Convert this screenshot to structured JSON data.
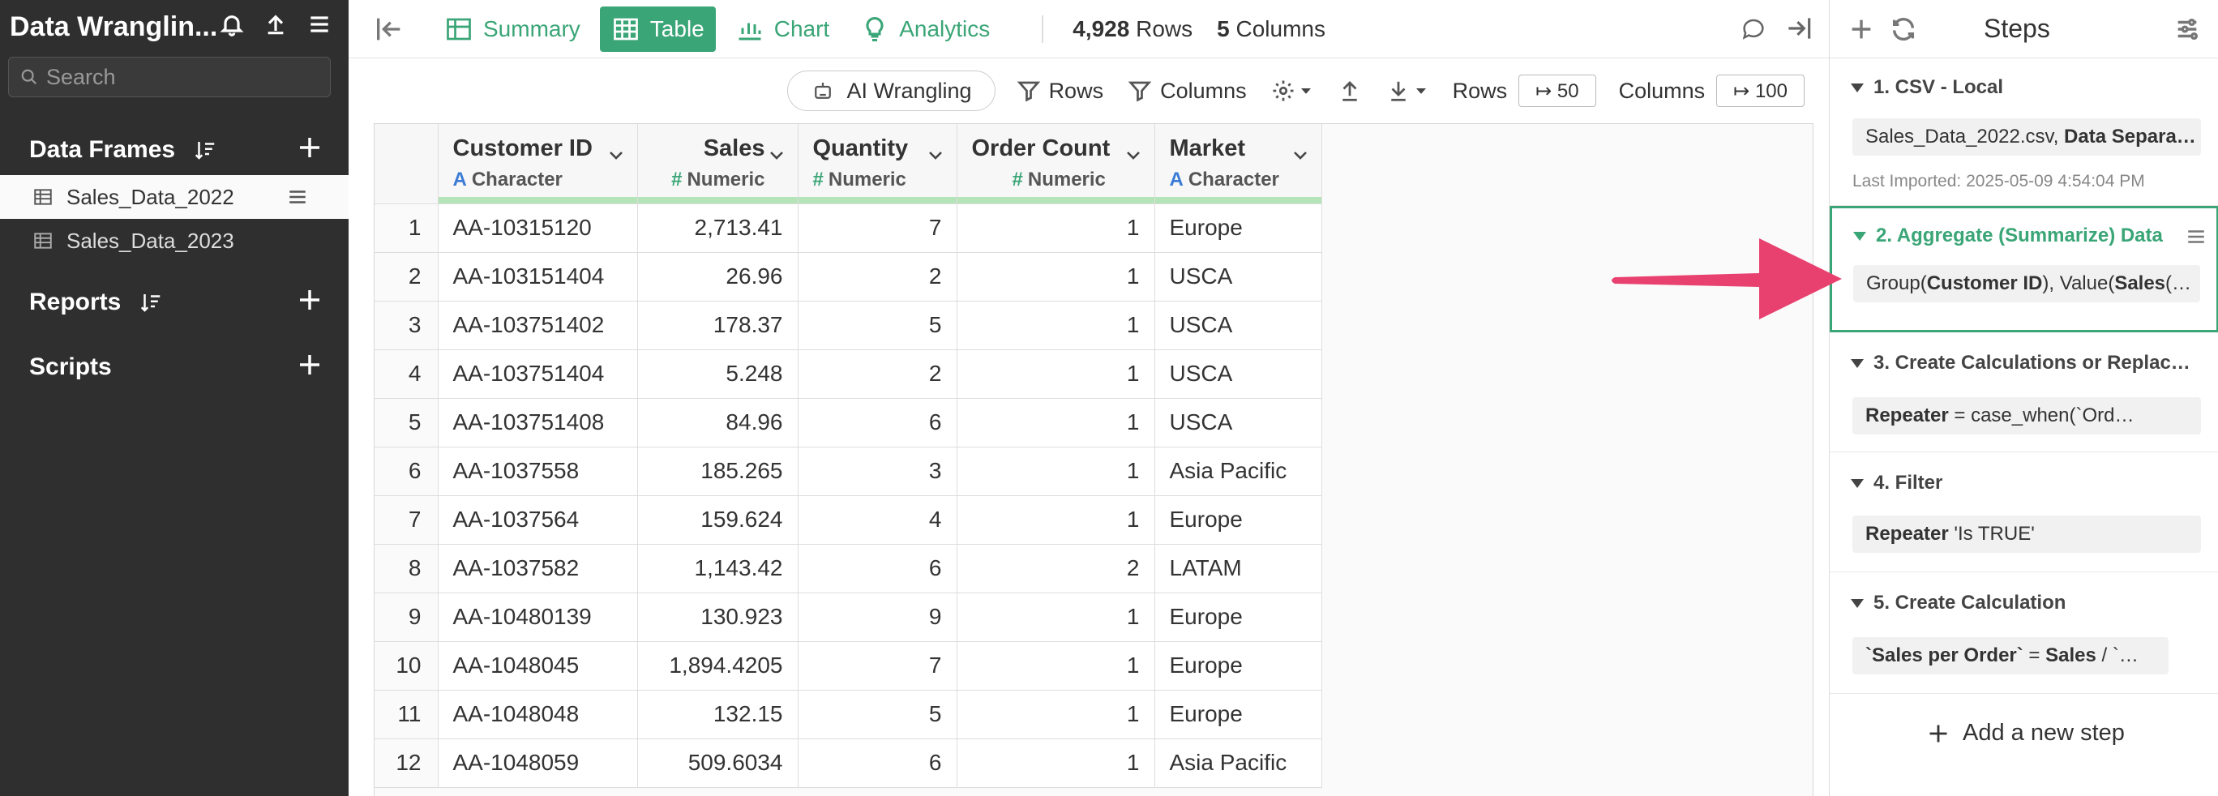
{
  "sidebar": {
    "title": "Data Wranglin...",
    "search_placeholder": "Search",
    "sections": {
      "data_frames": "Data Frames",
      "reports": "Reports",
      "scripts": "Scripts"
    },
    "frames": [
      "Sales_Data_2022",
      "Sales_Data_2023"
    ]
  },
  "topbar": {
    "tabs": [
      "Summary",
      "Table",
      "Chart",
      "Analytics"
    ],
    "active_tab": "Table",
    "rows_count": "4,928",
    "rows_label": "Rows",
    "cols_count": "5",
    "cols_label": "Columns"
  },
  "toolbar": {
    "ai": "AI Wrangling",
    "rows": "Rows",
    "columns": "Columns",
    "rows_label": "Rows",
    "rows_value": "↦ 50",
    "cols_label": "Columns",
    "cols_value": "↦ 100"
  },
  "table": {
    "columns": [
      {
        "name": "Customer ID",
        "type": "Character"
      },
      {
        "name": "Sales",
        "type": "Numeric"
      },
      {
        "name": "Quantity",
        "type": "Numeric"
      },
      {
        "name": "Order Count",
        "type": "Numeric"
      },
      {
        "name": "Market",
        "type": "Character"
      }
    ],
    "rows": [
      [
        "1",
        "AA-10315120",
        "2,713.41",
        "7",
        "1",
        "Europe"
      ],
      [
        "2",
        "AA-103151404",
        "26.96",
        "2",
        "1",
        "USCA"
      ],
      [
        "3",
        "AA-103751402",
        "178.37",
        "5",
        "1",
        "USCA"
      ],
      [
        "4",
        "AA-103751404",
        "5.248",
        "2",
        "1",
        "USCA"
      ],
      [
        "5",
        "AA-103751408",
        "84.96",
        "6",
        "1",
        "USCA"
      ],
      [
        "6",
        "AA-1037558",
        "185.265",
        "3",
        "1",
        "Asia Pacific"
      ],
      [
        "7",
        "AA-1037564",
        "159.624",
        "4",
        "1",
        "Europe"
      ],
      [
        "8",
        "AA-1037582",
        "1,143.42",
        "6",
        "2",
        "LATAM"
      ],
      [
        "9",
        "AA-10480139",
        "130.923",
        "9",
        "1",
        "Europe"
      ],
      [
        "10",
        "AA-1048045",
        "1,894.4205",
        "7",
        "1",
        "Europe"
      ],
      [
        "11",
        "AA-1048048",
        "132.15",
        "5",
        "1",
        "Europe"
      ],
      [
        "12",
        "AA-1048059",
        "509.6034",
        "6",
        "1",
        "Asia Pacific"
      ]
    ]
  },
  "steps": {
    "title": "Steps",
    "items": [
      {
        "header": "1. CSV - Local",
        "body_plain": "Sales_Data_2022.csv, ",
        "body_bold": "Data Separa…",
        "meta": "Last Imported: 2025-05-09 4:54:04 PM"
      },
      {
        "header": "2. Aggregate (Summarize) Data",
        "body_a": "Group(",
        "body_b": "Customer ID",
        "body_c": "), Value(",
        "body_d": "Sales",
        "body_e": " (…"
      },
      {
        "header": "3. Create Calculations or Replac…",
        "body_bold": "Repeater",
        "body_plain": " = case_when(`Ord…"
      },
      {
        "header": "4. Filter",
        "body_bold": "Repeater",
        "body_plain": " 'Is TRUE'"
      },
      {
        "header": "5. Create Calculation",
        "body_bold": "`Sales per Order`",
        "body_plain": " = ",
        "body_bold2": "Sales",
        "body_plain2": " / `…"
      }
    ],
    "add": "Add a new step"
  },
  "colors": {
    "accent": "#3aa576",
    "arrow": "#e8416f",
    "sidebar": "#2f2f2f"
  }
}
